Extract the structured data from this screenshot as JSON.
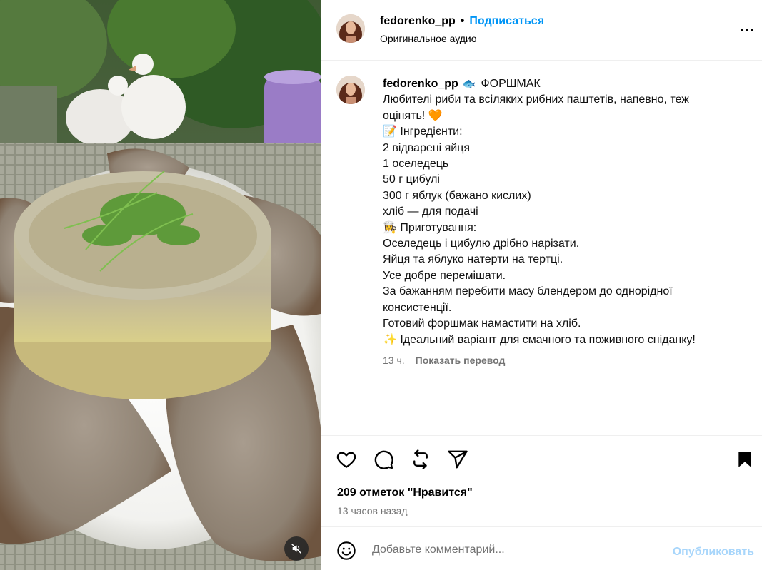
{
  "header": {
    "username": "fedorenko_pp",
    "separator": "•",
    "follow_label": "Подписаться",
    "audio_label": "Оригинальное аудио"
  },
  "caption": {
    "username": "fedorenko_pp",
    "title_emoji": "🐟",
    "title": "ФОРШМАК",
    "lines": [
      "Любителі риби та всіляких рибних паштетів, напевно, теж",
      "оцінять! 🧡",
      "📝 Інгредієнти:",
      "2 відварені яйця",
      "1 оселедець",
      "50 г цибулі",
      "300 г яблук (бажано кислих)",
      "хліб — для подачі",
      "👩‍🍳 Приготування:",
      "Оселедець і цибулю дрібно нарізати.",
      "Яйця та яблуко натерти на тертці.",
      "Усе добре перемішати.",
      "За бажанням перебити масу блендером до однорідної",
      "консистенції.",
      "Готовий форшмак намастити на хліб.",
      "✨ Ідеальний варіант для смачного та поживного сніданку!"
    ],
    "time_ago": "13 ч.",
    "translate_label": "Показать перевод"
  },
  "actions": {
    "icons": [
      "heart-icon",
      "comment-icon",
      "repost-icon",
      "share-icon",
      "bookmark-icon"
    ],
    "likes_text": "209 отметок \"Нравится\"",
    "posted_time": "13 часов назад"
  },
  "comment": {
    "placeholder": "Добавьте комментарий...",
    "publish_label": "Опубликовать"
  },
  "colors": {
    "accent": "#0095f6",
    "publish_disabled": "#a8d6fb",
    "secondary_text": "#737373",
    "divider": "#efefef"
  }
}
